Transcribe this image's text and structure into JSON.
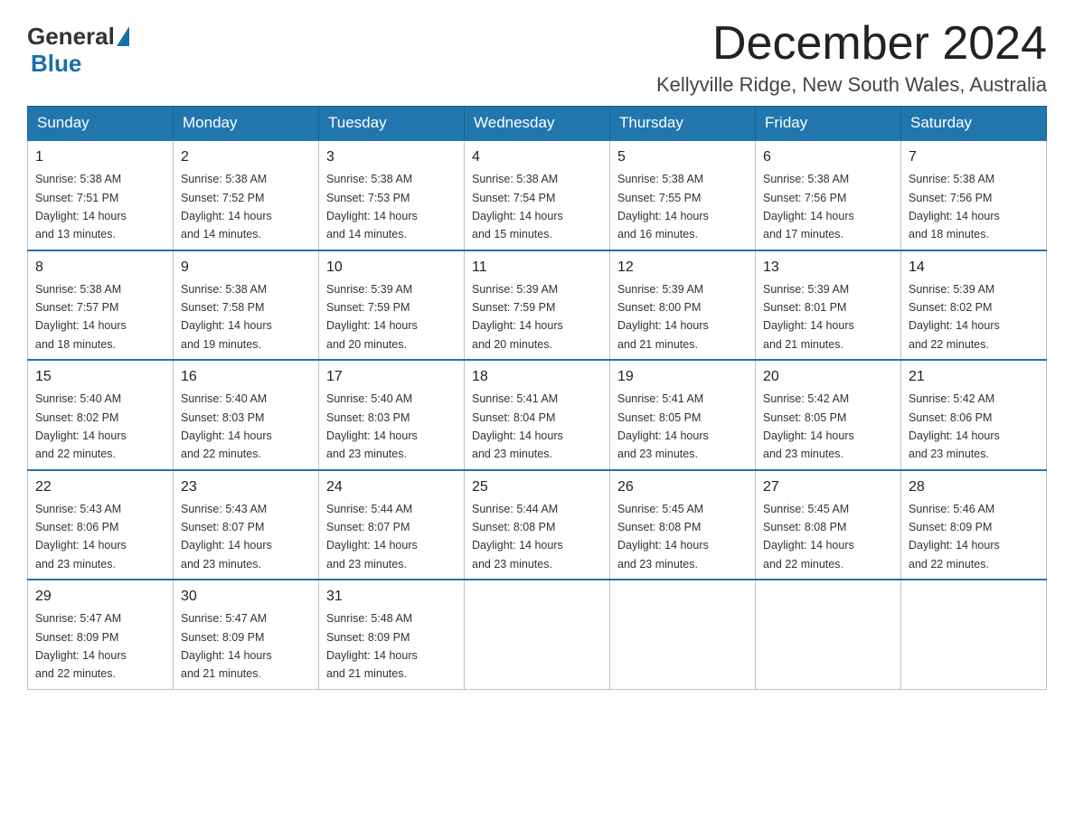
{
  "header": {
    "logo_general": "General",
    "logo_blue": "Blue",
    "month_title": "December 2024",
    "location": "Kellyville Ridge, New South Wales, Australia"
  },
  "weekdays": [
    "Sunday",
    "Monday",
    "Tuesday",
    "Wednesday",
    "Thursday",
    "Friday",
    "Saturday"
  ],
  "weeks": [
    [
      {
        "day": "1",
        "sunrise": "5:38 AM",
        "sunset": "7:51 PM",
        "daylight": "14 hours and 13 minutes."
      },
      {
        "day": "2",
        "sunrise": "5:38 AM",
        "sunset": "7:52 PM",
        "daylight": "14 hours and 14 minutes."
      },
      {
        "day": "3",
        "sunrise": "5:38 AM",
        "sunset": "7:53 PM",
        "daylight": "14 hours and 14 minutes."
      },
      {
        "day": "4",
        "sunrise": "5:38 AM",
        "sunset": "7:54 PM",
        "daylight": "14 hours and 15 minutes."
      },
      {
        "day": "5",
        "sunrise": "5:38 AM",
        "sunset": "7:55 PM",
        "daylight": "14 hours and 16 minutes."
      },
      {
        "day": "6",
        "sunrise": "5:38 AM",
        "sunset": "7:56 PM",
        "daylight": "14 hours and 17 minutes."
      },
      {
        "day": "7",
        "sunrise": "5:38 AM",
        "sunset": "7:56 PM",
        "daylight": "14 hours and 18 minutes."
      }
    ],
    [
      {
        "day": "8",
        "sunrise": "5:38 AM",
        "sunset": "7:57 PM",
        "daylight": "14 hours and 18 minutes."
      },
      {
        "day": "9",
        "sunrise": "5:38 AM",
        "sunset": "7:58 PM",
        "daylight": "14 hours and 19 minutes."
      },
      {
        "day": "10",
        "sunrise": "5:39 AM",
        "sunset": "7:59 PM",
        "daylight": "14 hours and 20 minutes."
      },
      {
        "day": "11",
        "sunrise": "5:39 AM",
        "sunset": "7:59 PM",
        "daylight": "14 hours and 20 minutes."
      },
      {
        "day": "12",
        "sunrise": "5:39 AM",
        "sunset": "8:00 PM",
        "daylight": "14 hours and 21 minutes."
      },
      {
        "day": "13",
        "sunrise": "5:39 AM",
        "sunset": "8:01 PM",
        "daylight": "14 hours and 21 minutes."
      },
      {
        "day": "14",
        "sunrise": "5:39 AM",
        "sunset": "8:02 PM",
        "daylight": "14 hours and 22 minutes."
      }
    ],
    [
      {
        "day": "15",
        "sunrise": "5:40 AM",
        "sunset": "8:02 PM",
        "daylight": "14 hours and 22 minutes."
      },
      {
        "day": "16",
        "sunrise": "5:40 AM",
        "sunset": "8:03 PM",
        "daylight": "14 hours and 22 minutes."
      },
      {
        "day": "17",
        "sunrise": "5:40 AM",
        "sunset": "8:03 PM",
        "daylight": "14 hours and 23 minutes."
      },
      {
        "day": "18",
        "sunrise": "5:41 AM",
        "sunset": "8:04 PM",
        "daylight": "14 hours and 23 minutes."
      },
      {
        "day": "19",
        "sunrise": "5:41 AM",
        "sunset": "8:05 PM",
        "daylight": "14 hours and 23 minutes."
      },
      {
        "day": "20",
        "sunrise": "5:42 AM",
        "sunset": "8:05 PM",
        "daylight": "14 hours and 23 minutes."
      },
      {
        "day": "21",
        "sunrise": "5:42 AM",
        "sunset": "8:06 PM",
        "daylight": "14 hours and 23 minutes."
      }
    ],
    [
      {
        "day": "22",
        "sunrise": "5:43 AM",
        "sunset": "8:06 PM",
        "daylight": "14 hours and 23 minutes."
      },
      {
        "day": "23",
        "sunrise": "5:43 AM",
        "sunset": "8:07 PM",
        "daylight": "14 hours and 23 minutes."
      },
      {
        "day": "24",
        "sunrise": "5:44 AM",
        "sunset": "8:07 PM",
        "daylight": "14 hours and 23 minutes."
      },
      {
        "day": "25",
        "sunrise": "5:44 AM",
        "sunset": "8:08 PM",
        "daylight": "14 hours and 23 minutes."
      },
      {
        "day": "26",
        "sunrise": "5:45 AM",
        "sunset": "8:08 PM",
        "daylight": "14 hours and 23 minutes."
      },
      {
        "day": "27",
        "sunrise": "5:45 AM",
        "sunset": "8:08 PM",
        "daylight": "14 hours and 22 minutes."
      },
      {
        "day": "28",
        "sunrise": "5:46 AM",
        "sunset": "8:09 PM",
        "daylight": "14 hours and 22 minutes."
      }
    ],
    [
      {
        "day": "29",
        "sunrise": "5:47 AM",
        "sunset": "8:09 PM",
        "daylight": "14 hours and 22 minutes."
      },
      {
        "day": "30",
        "sunrise": "5:47 AM",
        "sunset": "8:09 PM",
        "daylight": "14 hours and 21 minutes."
      },
      {
        "day": "31",
        "sunrise": "5:48 AM",
        "sunset": "8:09 PM",
        "daylight": "14 hours and 21 minutes."
      },
      null,
      null,
      null,
      null
    ]
  ],
  "labels": {
    "sunrise": "Sunrise:",
    "sunset": "Sunset:",
    "daylight": "Daylight:"
  }
}
